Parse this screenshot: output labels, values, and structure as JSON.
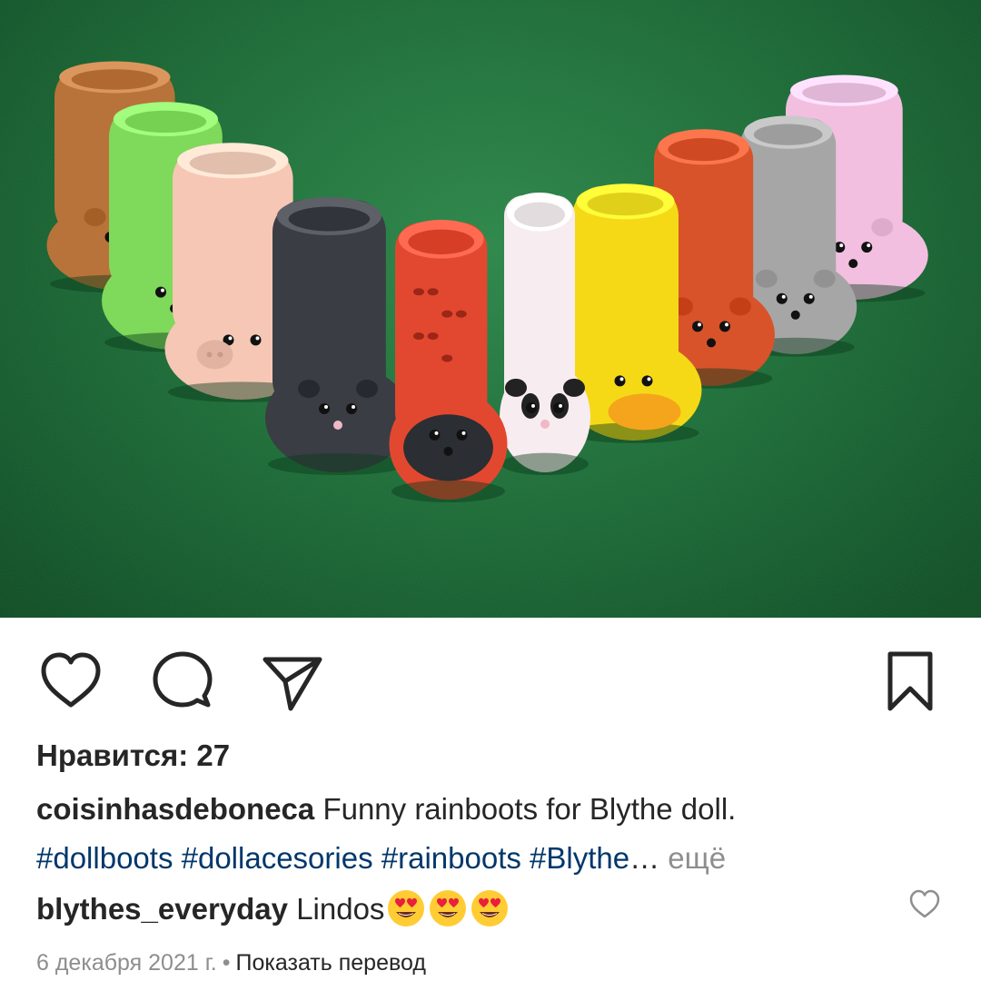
{
  "post": {
    "image_alt": "Handmade foam rainboots for Blythe doll on green felt",
    "colors": {
      "felt": "#1f6e39",
      "hashtag": "#00376b",
      "muted": "#8e8e8e",
      "text": "#262626"
    }
  },
  "actions": {
    "like_icon": "heart-outline-icon",
    "comment_icon": "speech-bubble-icon",
    "share_icon": "paper-plane-icon",
    "save_icon": "bookmark-icon"
  },
  "likes_text": "Нравится: 27",
  "caption": {
    "username": "coisinhasdeboneca",
    "text": "Funny rainboots for Blythe doll.",
    "hashtags": [
      "#dollboots",
      "#dollacesories",
      "#rainboots",
      "#Blythe"
    ],
    "truncation": "…",
    "more_label": "ещё"
  },
  "comment": {
    "username": "blythes_everyday",
    "text": "Lindos",
    "emojis": [
      "heart-eyes-emoji",
      "heart-eyes-emoji",
      "heart-eyes-emoji"
    ],
    "like_icon": "small-heart-outline-icon"
  },
  "meta": {
    "date": "6 декабря 2021 г.",
    "separator": "•",
    "translate_label": "Показать перевод"
  },
  "boots": [
    {
      "animal": "bear",
      "color": "#b8733a"
    },
    {
      "animal": "frog",
      "color": "#7fd95a"
    },
    {
      "animal": "pig",
      "color": "#f6c7b5"
    },
    {
      "animal": "mouse",
      "color": "#3a3d44"
    },
    {
      "animal": "ladybug",
      "color": "#e2482f"
    },
    {
      "animal": "panda",
      "color": "#f7ecef"
    },
    {
      "animal": "duck",
      "color": "#f6d916"
    },
    {
      "animal": "fox",
      "color": "#d8532a"
    },
    {
      "animal": "cat",
      "color": "#a6a6a6"
    },
    {
      "animal": "bunny",
      "color": "#f2bfe0"
    }
  ]
}
